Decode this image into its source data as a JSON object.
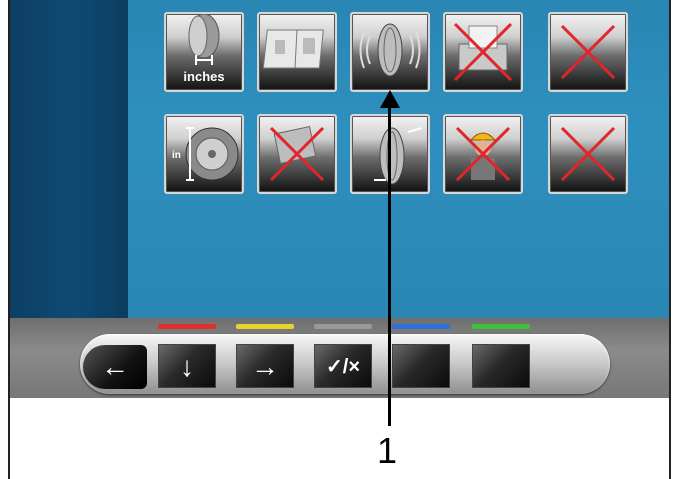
{
  "menu": {
    "row1": [
      {
        "icon": "rim-width-icon",
        "label": "inches"
      },
      {
        "icon": "measurement-print-icon",
        "label": ""
      },
      {
        "icon": "tyre-vibration-icon",
        "label": ""
      },
      {
        "icon": "printer-disabled-icon",
        "label": ""
      },
      {
        "icon": "disabled-icon",
        "label": ""
      }
    ],
    "row2": [
      {
        "icon": "rim-diameter-icon",
        "label": "in"
      },
      {
        "icon": "function-disabled-icon",
        "label": ""
      },
      {
        "icon": "tyre-mounting-icon",
        "label": ""
      },
      {
        "icon": "operator-disabled-icon",
        "label": ""
      },
      {
        "icon": "disabled-icon",
        "label": ""
      }
    ]
  },
  "toolbar": {
    "back_glyph": "←",
    "down_glyph": "↓",
    "next_glyph": "→",
    "toggle_glyph": "✓/×",
    "stripes": [
      "#e0302c",
      "#e6d42a",
      "#9a9a9a",
      "#2f6fd8",
      "#3cc23a"
    ]
  },
  "callout": {
    "number": "1"
  }
}
